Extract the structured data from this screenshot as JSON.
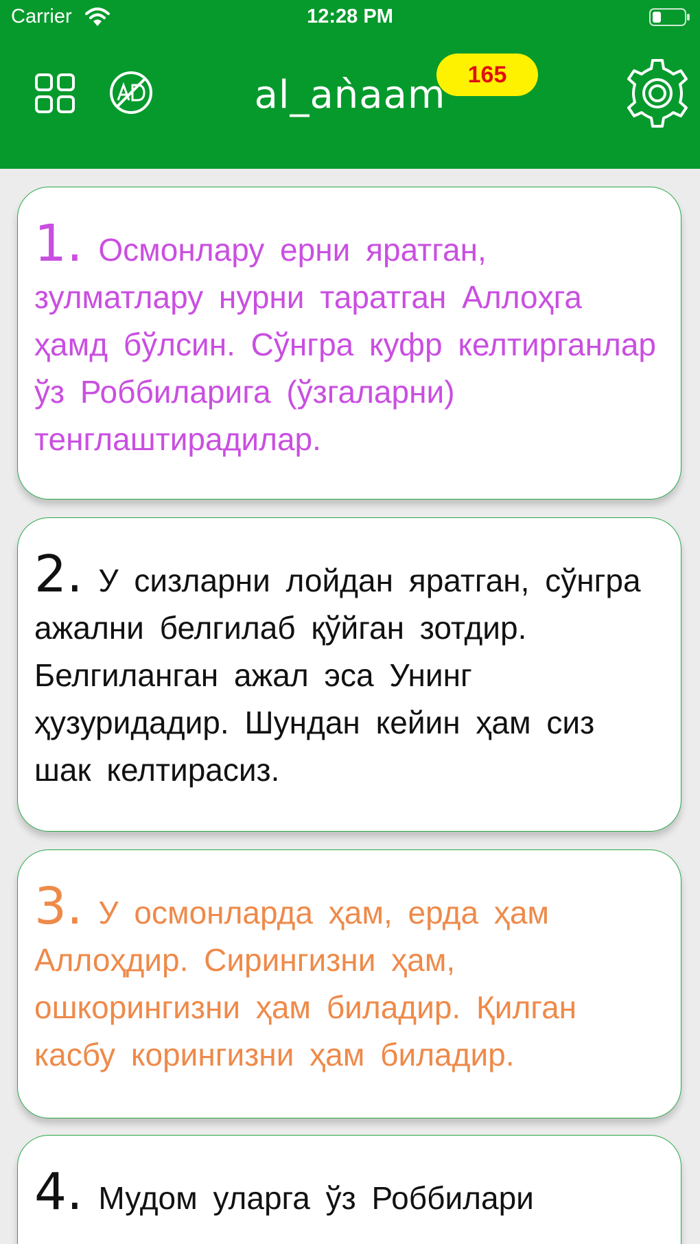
{
  "status_bar": {
    "carrier": "Carrier",
    "time": "12:28 PM",
    "wifi_icon": "wifi-icon",
    "battery_icon": "battery-icon"
  },
  "nav_bar": {
    "title": "al_aǹaam",
    "badge_count": "165",
    "background_color": "#069a2c",
    "badge_color": "#fff200",
    "badge_text_color": "#e01010",
    "icons": [
      "grid-menu-icon",
      "no-ads-icon",
      "settings-gear-icon"
    ]
  },
  "verses": [
    {
      "number": "1.",
      "text": "Осмонлару ерни яратган, зулматлару нурни таратган Аллоҳга ҳамд бўлсин. Сўнгра куфр келтирганлар ўз Роббиларига (ўзгаларни) тенглаштирадилар.",
      "color": "#c94fe0"
    },
    {
      "number": "2.",
      "text": "У сизларни лойдан яратган, сўнгра ажални белгилаб қўйган зотдир. Белгиланган ажал эса Унинг ҳузуридадир. Шундан кейин ҳам сиз шак келтирасиз.",
      "color": "#111111"
    },
    {
      "number": "3.",
      "text": "У осмонларда ҳам, ерда ҳам Аллоҳдир. Сирингизни ҳам, ошкорингизни ҳам биладир. Қилган касбу корингизни ҳам биладир.",
      "color": "#ee8a4a"
    },
    {
      "number": "4.",
      "text": "Мудом уларга ўз Роббилари",
      "color": "#111111"
    }
  ]
}
